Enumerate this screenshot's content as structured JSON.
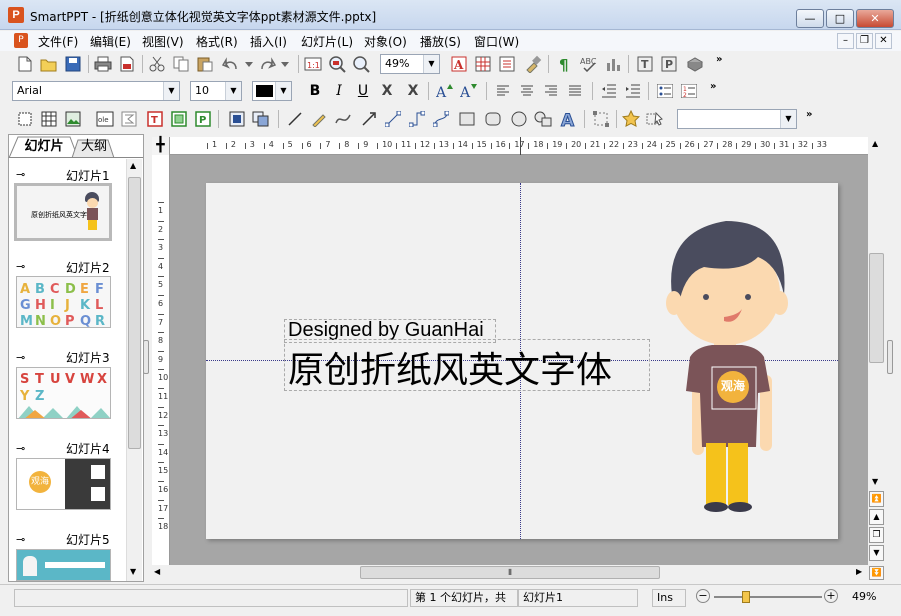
{
  "window": {
    "app_icon": "P",
    "title": "SmartPPT - [折纸创意立体化视觉英文字体ppt素材源文件.pptx]",
    "min_label": "—",
    "max_label": "□",
    "close_label": "✕"
  },
  "menu": {
    "items": [
      "文件(F)",
      "编辑(E)",
      "视图(V)",
      "格式(R)",
      "插入(I)",
      "幻灯片(L)",
      "对象(O)",
      "播放(S)",
      "窗口(W)"
    ],
    "mdi_min": "–",
    "mdi_restore": "❐",
    "mdi_close": "✕"
  },
  "toolbar1": {
    "zoom_value": "49%",
    "overflow": "»"
  },
  "toolbar2": {
    "font_name": "Arial",
    "font_size": "10",
    "bold": "B",
    "italic": "I",
    "underline": "U",
    "strike": "X",
    "strike2": "X",
    "overflow": "»"
  },
  "toolbar3": {
    "style_value": "",
    "overflow": "»"
  },
  "panel": {
    "tabs": [
      "幻灯片",
      "大纲"
    ],
    "slides": [
      {
        "label": "幻灯片1",
        "caption": "原创折纸风英文字体"
      },
      {
        "label": "幻灯片2",
        "caption": "ABCDEF GHIJKL MNOPQR"
      },
      {
        "label": "幻灯片3",
        "caption": "STUVWX YZ"
      },
      {
        "label": "幻灯片4",
        "caption": "观海"
      },
      {
        "label": "幻灯片5",
        "caption": ""
      }
    ]
  },
  "slide": {
    "subtitle": "Designed by GuanHai",
    "title": "原创折纸风英文字体",
    "badge": "观海"
  },
  "ruler": {
    "h_numbers": [
      "1",
      "2",
      "3",
      "4",
      "5",
      "6",
      "7",
      "8",
      "9",
      "10",
      "11",
      "12",
      "13",
      "14",
      "15",
      "16",
      "17",
      "18",
      "19",
      "20",
      "21",
      "22",
      "23",
      "24",
      "25",
      "26",
      "27",
      "28",
      "29",
      "30",
      "31",
      "32",
      "33"
    ],
    "v_numbers": [
      "1",
      "2",
      "3",
      "4",
      "5",
      "6",
      "7",
      "8",
      "9",
      "10",
      "11",
      "12",
      "13",
      "14",
      "15",
      "16",
      "17",
      "18"
    ]
  },
  "status": {
    "position": "第 1 个幻灯片，共",
    "slide_name": "幻灯片1",
    "mode": "Ins",
    "zoom": "49%",
    "zoom_level": 0.49
  },
  "colors": {
    "accent": "#d9531e",
    "hair": "#4a4c5e",
    "skin": "#fbd9b0",
    "shirt": "#7b5458",
    "pants": "#f5c21b",
    "badge": "#f2b33d"
  }
}
